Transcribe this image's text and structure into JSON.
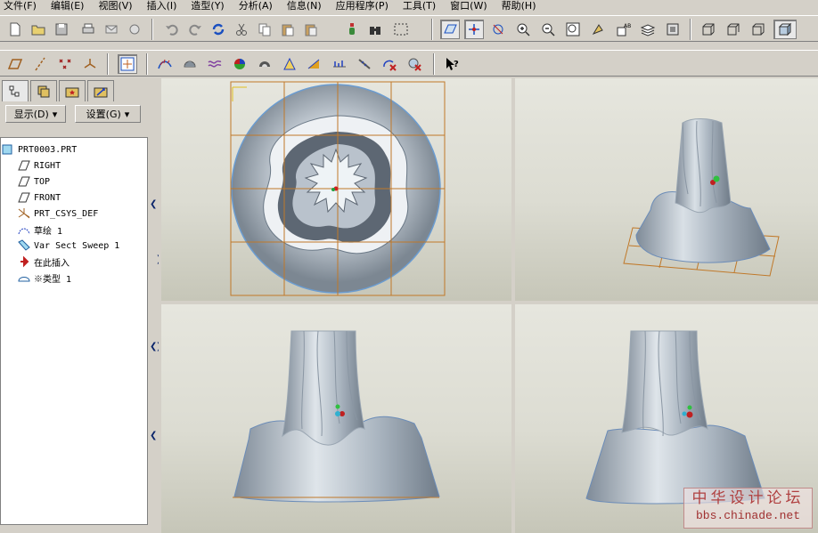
{
  "menubar": {
    "items": [
      "文件(F)",
      "编辑(E)",
      "视图(V)",
      "插入(I)",
      "造型(Y)",
      "分析(A)",
      "信息(N)",
      "应用程序(P)",
      "工具(T)",
      "窗口(W)",
      "帮助(H)"
    ]
  },
  "toolbar_main": {
    "icons": [
      "new-file-icon",
      "open-file-icon",
      "save-icon",
      "print-icon",
      "send-mail-icon",
      "send-print-icon",
      "undo-icon",
      "redo-icon",
      "regenerate-icon",
      "cut-icon",
      "copy-icon",
      "paste-icon",
      "paste-special-icon",
      "model-player-icon",
      "find-icon",
      "selection-box-icon",
      "toggle-datum-planes-icon",
      "toggle-axes-icon",
      "toggle-points-icon",
      "zoom-in-icon",
      "zoom-out-icon",
      "refit-icon",
      "reorient-icon",
      "named-view-icon",
      "layers-icon",
      "view-manager-icon",
      "wireframe-icon",
      "hidden-line-icon",
      "no-hidden-icon",
      "shading-icon"
    ]
  },
  "toolbar_secondary": {
    "icons": [
      "datum-plane-icon",
      "datum-axis-icon",
      "datum-point-icon",
      "datum-csys-icon",
      "sketch-tool-icon",
      "curvature-analysis-icon",
      "section-analysis-icon",
      "offset-analysis-icon",
      "shaded-curvature-icon",
      "draft-analysis-icon",
      "slope-analysis-icon",
      "reflection-icon",
      "dihedral-icon",
      "deviation-icon",
      "delete-analysis-icon",
      "delete-all-analysis-icon",
      "whats-this-icon"
    ]
  },
  "model_tree": {
    "tabs": [
      "model-tree-icon",
      "layer-tree-icon",
      "favorites-icon",
      "feature-tree-icon"
    ],
    "show_button": "显示(D)",
    "settings_button": "设置(G)",
    "items": [
      {
        "label": "PRT0003.PRT",
        "icon": "part-icon"
      },
      {
        "label": "RIGHT",
        "icon": "datum-plane-icon"
      },
      {
        "label": "TOP",
        "icon": "datum-plane-icon"
      },
      {
        "label": "FRONT",
        "icon": "datum-plane-icon"
      },
      {
        "label": "PRT_CSYS_DEF",
        "icon": "csys-icon"
      },
      {
        "label": "草绘 1",
        "icon": "sketch-icon"
      },
      {
        "label": "Var Sect Sweep 1",
        "icon": "sweep-icon"
      },
      {
        "label": "在此插入",
        "icon": "insert-here-icon"
      },
      {
        "label": "※类型 1",
        "icon": "style-icon"
      }
    ]
  },
  "viewports": {
    "top_left": "top-view",
    "top_right": "isometric-view",
    "bottom_left": "front-view",
    "bottom_right": "side-view"
  },
  "colors": {
    "background_top": "#e6e6de",
    "background_bottom": "#c6c6b8",
    "datum_grid": "#c07828",
    "model_surface": "#a9b4c0",
    "model_edge": "#6b8cb8",
    "active_view_border": "#1030a0"
  },
  "watermark": {
    "title": "中华设计论坛",
    "url": "bbs.chinade.net"
  }
}
